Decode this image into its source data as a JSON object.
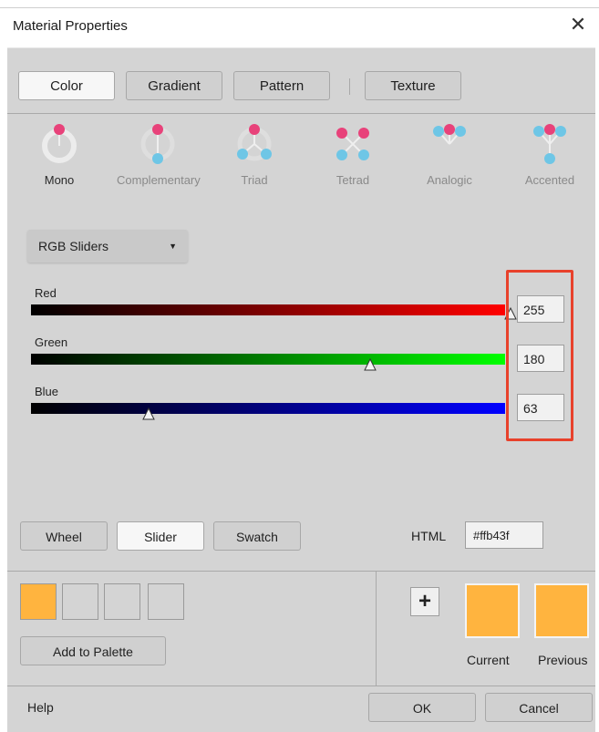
{
  "dialog": {
    "title": "Material Properties"
  },
  "tabs": [
    {
      "label": "Color",
      "active": true
    },
    {
      "label": "Gradient",
      "active": false
    },
    {
      "label": "Pattern",
      "active": false
    },
    {
      "label": "Texture",
      "active": false
    }
  ],
  "harmony": [
    {
      "label": "Mono",
      "active": true
    },
    {
      "label": "Complementary",
      "active": false
    },
    {
      "label": "Triad",
      "active": false
    },
    {
      "label": "Tetrad",
      "active": false
    },
    {
      "label": "Analogic",
      "active": false
    },
    {
      "label": "Accented",
      "active": false
    }
  ],
  "mode_dropdown": {
    "value": "RGB Sliders"
  },
  "sliders": [
    {
      "label": "Red",
      "value": "255",
      "max": 255,
      "color": "#ff0000"
    },
    {
      "label": "Green",
      "value": "180",
      "max": 255,
      "color": "#00ff00"
    },
    {
      "label": "Blue",
      "value": "63",
      "max": 255,
      "color": "#0000ff"
    }
  ],
  "view_buttons": [
    {
      "label": "Wheel",
      "active": false
    },
    {
      "label": "Slider",
      "active": true
    },
    {
      "label": "Swatch",
      "active": false
    }
  ],
  "html_field": {
    "label": "HTML",
    "value": "#ffb43f"
  },
  "palette": {
    "add_label": "Add to Palette",
    "first_color": "#ffb43f"
  },
  "preview": {
    "current_label": "Current",
    "previous_label": "Previous",
    "current_color": "#ffb43f",
    "previous_color": "#ffb43f"
  },
  "footer": {
    "help": "Help",
    "ok": "OK",
    "cancel": "Cancel"
  },
  "colors": {
    "accent_pink": "#e8427a",
    "accent_blue": "#6ec6e6",
    "highlight": "#e8412b"
  }
}
